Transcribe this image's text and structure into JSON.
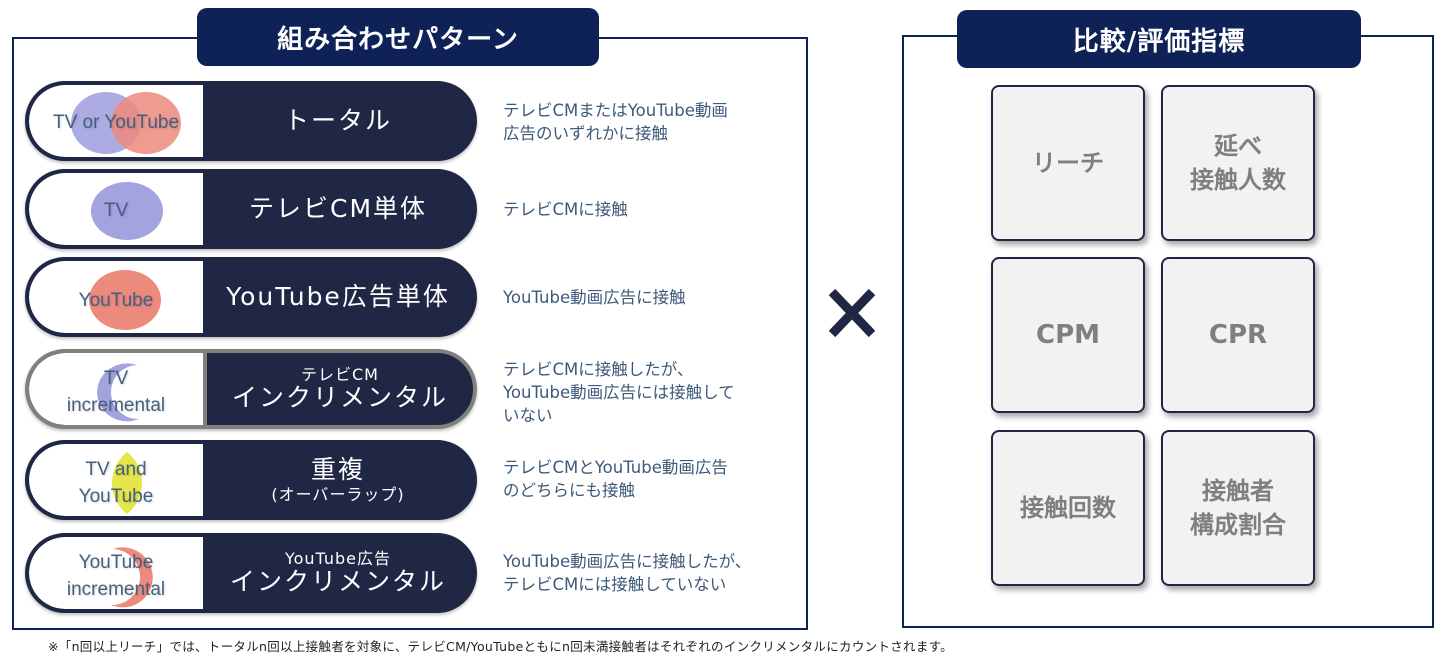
{
  "left_panel": {
    "title": "組み合わせパターン",
    "rows": [
      {
        "venn_label": "TV or YouTube",
        "name_sub": "",
        "name_main": "トータル",
        "description": "テレビCMまたはYouTube動画\n広告のいずれかに接触"
      },
      {
        "venn_label": "TV",
        "name_sub": "",
        "name_main": "テレビCM単体",
        "description": "テレビCMに接触"
      },
      {
        "venn_label": "YouTube",
        "name_sub": "",
        "name_main": "YouTube広告単体",
        "description": "YouTube動画広告に接触"
      },
      {
        "venn_label": "TV\nincremental",
        "name_sub": "テレビCM",
        "name_main": "インクリメンタル",
        "description": "テレビCMに接触したが、\nYouTube動画広告には接触して\nいない"
      },
      {
        "venn_label": "TV and\nYouTube",
        "name_main": "重複",
        "name_sub": "(オーバーラップ)",
        "description": "テレビCMとYouTube動画広告\nのどちらにも接触"
      },
      {
        "venn_label": "YouTube\nincremental",
        "name_sub": "YouTube広告",
        "name_main": "インクリメンタル",
        "description": "YouTube動画広告に接触したが、\nテレビCMには接触していない"
      }
    ]
  },
  "operator": {
    "icon": "times-icon"
  },
  "right_panel": {
    "title": "比較/評価指標",
    "cards": [
      {
        "label": "リーチ"
      },
      {
        "label": "延べ\n接触人数"
      },
      {
        "label": "CPM"
      },
      {
        "label": "CPR"
      },
      {
        "label": "接触回数"
      },
      {
        "label": "接触者\n構成割合"
      }
    ]
  },
  "footnote": "※「n回以上リーチ」では、トータルn回以上接触者を対象に、テレビCM/YouTubeともにn回未満接触者はそれぞれのインクリメンタルにカウントされます。",
  "colors": {
    "navy": "#0e2258",
    "row_dark": "#1f2744",
    "tv_purple": "#a3a3e0",
    "youtube_salmon": "#ec8a7c",
    "overlap_yellow": "#e6e64a",
    "card_bg": "#f2f2f2",
    "card_text": "#7f7f7f"
  }
}
